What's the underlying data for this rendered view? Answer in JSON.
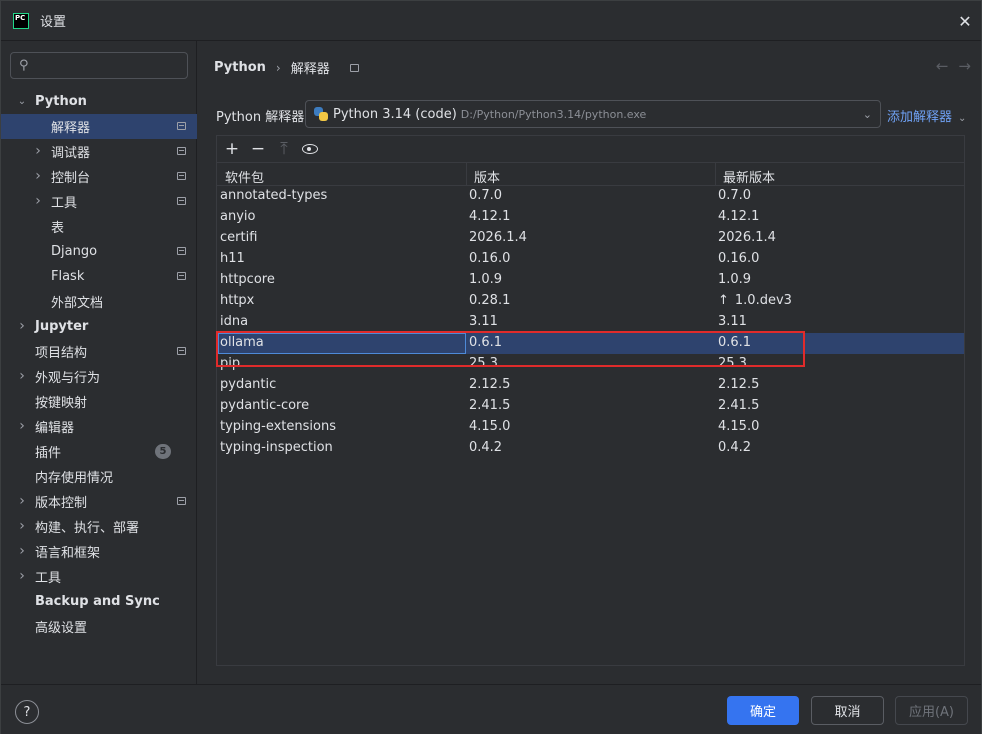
{
  "window": {
    "title": "设置",
    "logo_text": "PC"
  },
  "search": {
    "placeholder": ""
  },
  "sidebar": {
    "items": [
      {
        "label": "Python",
        "expanded": true
      },
      {
        "label": "解释器",
        "selected": true
      },
      {
        "label": "调试器"
      },
      {
        "label": "控制台"
      },
      {
        "label": "工具"
      },
      {
        "label": "表"
      },
      {
        "label": "Django"
      },
      {
        "label": "Flask"
      },
      {
        "label": "外部文档"
      },
      {
        "label": "Jupyter"
      },
      {
        "label": "项目结构"
      },
      {
        "label": "外观与行为"
      },
      {
        "label": "按键映射"
      },
      {
        "label": "编辑器"
      },
      {
        "label": "插件",
        "badge": "5"
      },
      {
        "label": "内存使用情况"
      },
      {
        "label": "版本控制"
      },
      {
        "label": "构建、执行、部署"
      },
      {
        "label": "语言和框架"
      },
      {
        "label": "工具"
      },
      {
        "label": "Backup and Sync"
      },
      {
        "label": "高级设置"
      }
    ]
  },
  "breadcrumb": {
    "root": "Python",
    "current": "解释器"
  },
  "interpreter": {
    "label": "Python 解释器:",
    "name": "Python 3.14 (code)",
    "path": "D:/Python/Python3.14/python.exe",
    "add_label": "添加解释器"
  },
  "table": {
    "headers": [
      "软件包",
      "版本",
      "最新版本"
    ],
    "rows": [
      {
        "name": "annotated-types",
        "version": "0.7.0",
        "latest": "0.7.0"
      },
      {
        "name": "anyio",
        "version": "4.12.1",
        "latest": "4.12.1"
      },
      {
        "name": "certifi",
        "version": "2026.1.4",
        "latest": "2026.1.4"
      },
      {
        "name": "h11",
        "version": "0.16.0",
        "latest": "0.16.0"
      },
      {
        "name": "httpcore",
        "version": "1.0.9",
        "latest": "1.0.9"
      },
      {
        "name": "httpx",
        "version": "0.28.1",
        "latest": "1.0.dev3",
        "upgrade": true
      },
      {
        "name": "idna",
        "version": "3.11",
        "latest": "3.11"
      },
      {
        "name": "ollama",
        "version": "0.6.1",
        "latest": "0.6.1",
        "selected": true
      },
      {
        "name": "pip",
        "version": "25.3",
        "latest": "25.3"
      },
      {
        "name": "pydantic",
        "version": "2.12.5",
        "latest": "2.12.5"
      },
      {
        "name": "pydantic-core",
        "version": "2.41.5",
        "latest": "2.41.5"
      },
      {
        "name": "typing-extensions",
        "version": "4.15.0",
        "latest": "4.15.0"
      },
      {
        "name": "typing-inspection",
        "version": "0.4.2",
        "latest": "0.4.2"
      }
    ]
  },
  "footer": {
    "help": "?",
    "ok": "确定",
    "cancel": "取消",
    "apply": "应用(A)"
  },
  "colors": {
    "accent": "#3574f0",
    "selection": "#2e436e",
    "link": "#6fa1f4",
    "highlight": "#e02b2b"
  }
}
